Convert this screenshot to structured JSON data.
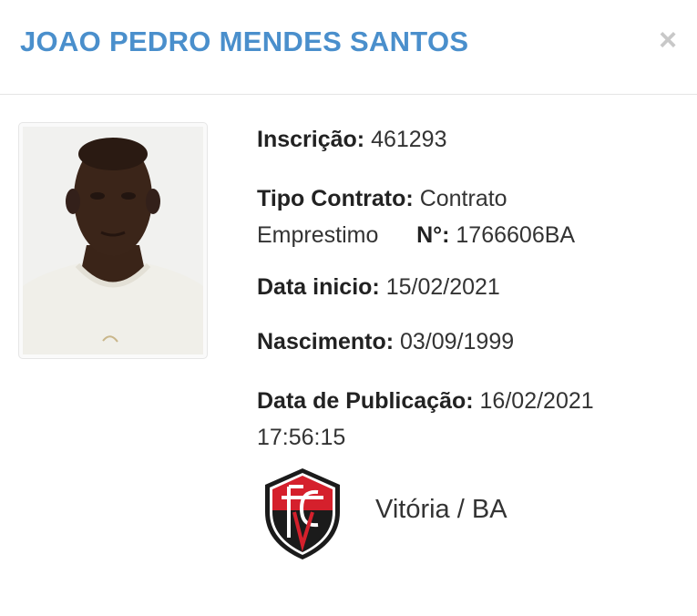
{
  "header": {
    "title": "JOAO PEDRO MENDES SANTOS",
    "close_icon": "×"
  },
  "photo": {
    "description_icon": "player-photo"
  },
  "details": {
    "inscricao_label": "Inscrição:",
    "inscricao_value": "461293",
    "tipo_label": "Tipo Contrato:",
    "tipo_value_1": "Contrato",
    "tipo_value_2": "Emprestimo",
    "numero_label": "N°:",
    "numero_value": "1766606BA",
    "data_inicio_label": "Data inicio:",
    "data_inicio_value": "15/02/2021",
    "nascimento_label": "Nascimento:",
    "nascimento_value": "03/09/1999",
    "publicacao_label": "Data de Publicação:",
    "publicacao_value_1": "16/02/2021",
    "publicacao_value_2": "17:56:15"
  },
  "club": {
    "name": "Vitória / BA",
    "shield_icon": "club-shield-icon",
    "colors": {
      "red": "#d5202c",
      "black": "#1b1b1b"
    }
  },
  "colors": {
    "title": "#4a8fcc",
    "close": "#c8c8c8",
    "divider": "#e5e5e5"
  }
}
